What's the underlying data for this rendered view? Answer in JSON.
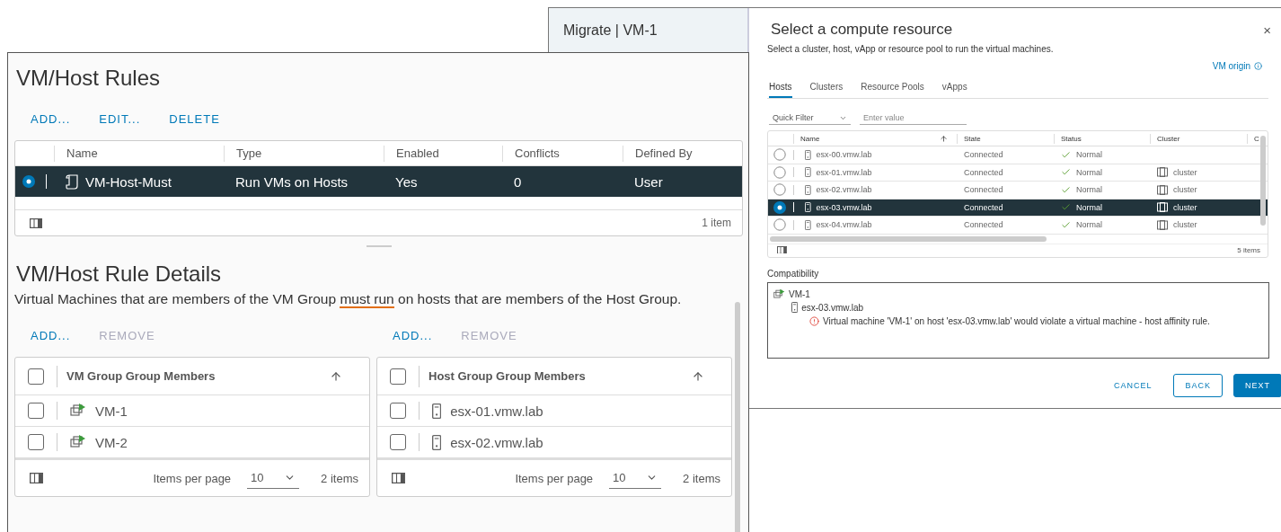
{
  "rules_window": {
    "title": "VM/Host Rules",
    "actions": [
      {
        "label": "ADD...",
        "disabled": false
      },
      {
        "label": "EDIT...",
        "disabled": false
      },
      {
        "label": "DELETE",
        "disabled": false
      }
    ],
    "table": {
      "columns": [
        "Name",
        "Type",
        "Enabled",
        "Conflicts",
        "Defined By"
      ],
      "rows": [
        {
          "selected": true,
          "name": "VM-Host-Must",
          "type": "Run VMs on Hosts",
          "enabled": "Yes",
          "conflicts": "0",
          "defined_by": "User"
        }
      ],
      "footer": "1 item"
    },
    "details": {
      "title": "VM/Host Rule Details",
      "description": {
        "before": "Virtual Machines that are members of the VM Group ",
        "highlight": "must run",
        "after": " on hosts that are members of the Host Group."
      },
      "groups": [
        {
          "actions": [
            {
              "label": "ADD...",
              "disabled": false
            },
            {
              "label": "REMOVE",
              "disabled": true
            }
          ],
          "column": "VM Group Group Members",
          "select_all": false,
          "members": [
            {
              "kind": "vm",
              "name": "VM-1",
              "checked": false
            },
            {
              "kind": "vm",
              "name": "VM-2",
              "checked": false
            }
          ],
          "items_per_page_label": "Items per page",
          "page_size": "10",
          "count": "2 items"
        },
        {
          "actions": [
            {
              "label": "ADD...",
              "disabled": false
            },
            {
              "label": "REMOVE",
              "disabled": true
            }
          ],
          "column": "Host Group Group Members",
          "select_all": false,
          "members": [
            {
              "kind": "host",
              "name": "esx-01.vmw.lab",
              "checked": false
            },
            {
              "kind": "host",
              "name": "esx-02.vmw.lab",
              "checked": false
            }
          ],
          "items_per_page_label": "Items per page",
          "page_size": "10",
          "count": "2 items"
        }
      ]
    }
  },
  "migrate_window": {
    "sidebar_title": "Migrate | VM-1",
    "title": "Select a compute resource",
    "subtitle": "Select a cluster, host, vApp or resource pool to run the virtual machines.",
    "close": "×",
    "vm_origin": "VM origin",
    "tabs": [
      {
        "label": "Hosts",
        "selected": true
      },
      {
        "label": "Clusters",
        "selected": false
      },
      {
        "label": "Resource Pools",
        "selected": false
      },
      {
        "label": "vApps",
        "selected": false
      }
    ],
    "filter": {
      "select": "Quick Filter",
      "placeholder": "Enter value"
    },
    "grid": {
      "columns": [
        "Name",
        "State",
        "Status",
        "Cluster",
        "C"
      ],
      "rows": [
        {
          "selected": false,
          "name": "esx-00.vmw.lab",
          "state": "Connected",
          "status": "Normal",
          "cluster": ""
        },
        {
          "selected": false,
          "name": "esx-01.vmw.lab",
          "state": "Connected",
          "status": "Normal",
          "cluster": "cluster"
        },
        {
          "selected": false,
          "name": "esx-02.vmw.lab",
          "state": "Connected",
          "status": "Normal",
          "cluster": "cluster"
        },
        {
          "selected": true,
          "name": "esx-03.vmw.lab",
          "state": "Connected",
          "status": "Normal",
          "cluster": "cluster"
        },
        {
          "selected": false,
          "name": "esx-04.vmw.lab",
          "state": "Connected",
          "status": "Normal",
          "cluster": "cluster"
        }
      ],
      "footer": "5 items"
    },
    "compatibility": {
      "label": "Compatibility",
      "tree": [
        {
          "kind": "vm",
          "label": "VM-1",
          "children": [
            {
              "kind": "host",
              "label": "esx-03.vmw.lab",
              "children": [
                {
                  "kind": "error",
                  "label": "Virtual machine 'VM-1' on host 'esx-03.vmw.lab' would violate a virtual machine - host affinity rule."
                }
              ]
            }
          ]
        }
      ]
    },
    "buttons": [
      {
        "label": "CANCEL",
        "kind": "link"
      },
      {
        "label": "BACK",
        "kind": "outline"
      },
      {
        "label": "NEXT",
        "kind": "primary"
      }
    ]
  }
}
